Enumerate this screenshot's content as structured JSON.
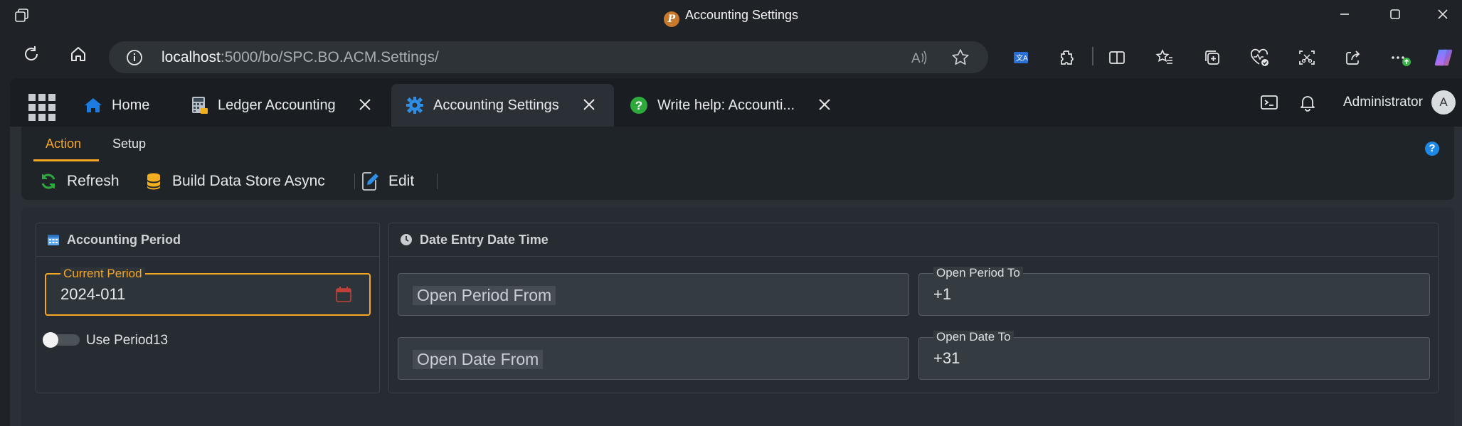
{
  "window": {
    "title": "Accounting Settings"
  },
  "browser": {
    "url_host": "localhost",
    "url_rest": ":5000/bo/SPC.BO.ACM.Settings/"
  },
  "tabs": [
    {
      "label": "Home",
      "icon": "home-icon"
    },
    {
      "label": "Ledger Accounting",
      "icon": "calculator-icon"
    },
    {
      "label": "Accounting Settings",
      "icon": "gear-icon"
    },
    {
      "label": "Write help: Accounti...",
      "icon": "question-icon"
    }
  ],
  "header": {
    "user_name": "Administrator",
    "avatar_initial": "A"
  },
  "subtabs": {
    "action": "Action",
    "setup": "Setup"
  },
  "toolbar": {
    "refresh": "Refresh",
    "build": "Build Data Store Async",
    "edit": "Edit"
  },
  "accounting_period": {
    "title": "Accounting Period",
    "current_period_label": "Current Period",
    "current_period_value": "2024-011",
    "use_period13_label": "Use Period13"
  },
  "date_entry": {
    "title": "Date Entry Date Time",
    "open_period_from_placeholder": "Open Period From",
    "open_period_to_label": "Open Period To",
    "open_period_to_value": "+1",
    "open_date_from_placeholder": "Open Date From",
    "open_date_to_label": "Open Date To",
    "open_date_to_value": "+31"
  },
  "colors": {
    "accent": "#f5a623",
    "brand_blue": "#1e88e5",
    "success_green": "#2eaa3c"
  }
}
